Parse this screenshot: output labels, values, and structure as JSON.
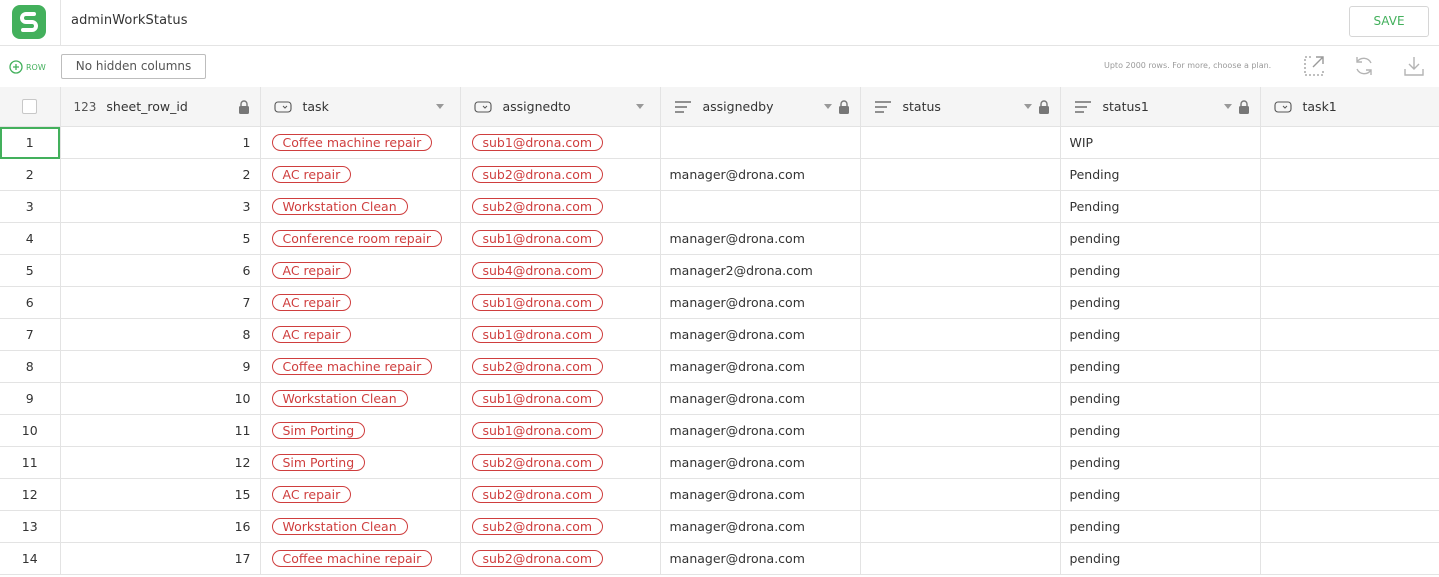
{
  "app": {
    "title": "adminWorkStatus",
    "save_label": "SAVE",
    "brand_color": "#43b05c"
  },
  "toolbar": {
    "add_row_label": "ROW",
    "hidden_columns_label": "No hidden columns",
    "plan_note": "Upto 2000 rows. For more, choose a plan.",
    "icons": [
      "open-external-icon",
      "refresh-icon",
      "download-icon"
    ]
  },
  "columns": [
    {
      "key": "sheet_row_id",
      "label": "sheet_row_id",
      "type_tag": "123",
      "locked": true
    },
    {
      "key": "task",
      "label": "task",
      "type": "select",
      "locked": false
    },
    {
      "key": "assignedto",
      "label": "assignedto",
      "type": "select",
      "locked": false
    },
    {
      "key": "assignedby",
      "label": "assignedby",
      "type": "text",
      "locked": true
    },
    {
      "key": "status",
      "label": "status",
      "type": "text",
      "locked": true
    },
    {
      "key": "status1",
      "label": "status1",
      "type": "text",
      "locked": true
    },
    {
      "key": "task1",
      "label": "task1",
      "type": "select",
      "locked": false
    }
  ],
  "rows": [
    {
      "n": "1",
      "sheet_row_id": "1",
      "task": "Coffee machine repair",
      "assignedto": "sub1@drona.com",
      "assignedby": "",
      "status": "",
      "status1": "WIP",
      "task1": ""
    },
    {
      "n": "2",
      "sheet_row_id": "2",
      "task": "AC repair",
      "assignedto": "sub2@drona.com",
      "assignedby": "manager@drona.com",
      "status": "",
      "status1": "Pending",
      "task1": ""
    },
    {
      "n": "3",
      "sheet_row_id": "3",
      "task": "Workstation Clean",
      "assignedto": "sub2@drona.com",
      "assignedby": "",
      "status": "",
      "status1": "Pending",
      "task1": ""
    },
    {
      "n": "4",
      "sheet_row_id": "5",
      "task": "Conference room repair",
      "assignedto": "sub1@drona.com",
      "assignedby": "manager@drona.com",
      "status": "",
      "status1": "pending",
      "task1": ""
    },
    {
      "n": "5",
      "sheet_row_id": "6",
      "task": "AC repair",
      "assignedto": "sub4@drona.com",
      "assignedby": "manager2@drona.com",
      "status": "",
      "status1": "pending",
      "task1": ""
    },
    {
      "n": "6",
      "sheet_row_id": "7",
      "task": "AC repair",
      "assignedto": "sub1@drona.com",
      "assignedby": "manager@drona.com",
      "status": "",
      "status1": "pending",
      "task1": ""
    },
    {
      "n": "7",
      "sheet_row_id": "8",
      "task": "AC repair",
      "assignedto": "sub1@drona.com",
      "assignedby": "manager@drona.com",
      "status": "",
      "status1": "pending",
      "task1": ""
    },
    {
      "n": "8",
      "sheet_row_id": "9",
      "task": "Coffee machine repair",
      "assignedto": "sub2@drona.com",
      "assignedby": "manager@drona.com",
      "status": "",
      "status1": "pending",
      "task1": ""
    },
    {
      "n": "9",
      "sheet_row_id": "10",
      "task": "Workstation Clean",
      "assignedto": "sub1@drona.com",
      "assignedby": "manager@drona.com",
      "status": "",
      "status1": "pending",
      "task1": ""
    },
    {
      "n": "10",
      "sheet_row_id": "11",
      "task": "Sim Porting",
      "assignedto": "sub1@drona.com",
      "assignedby": "manager@drona.com",
      "status": "",
      "status1": "pending",
      "task1": ""
    },
    {
      "n": "11",
      "sheet_row_id": "12",
      "task": "Sim Porting",
      "assignedto": "sub2@drona.com",
      "assignedby": "manager@drona.com",
      "status": "",
      "status1": "pending",
      "task1": ""
    },
    {
      "n": "12",
      "sheet_row_id": "15",
      "task": "AC repair",
      "assignedto": "sub2@drona.com",
      "assignedby": "manager@drona.com",
      "status": "",
      "status1": "pending",
      "task1": ""
    },
    {
      "n": "13",
      "sheet_row_id": "16",
      "task": "Workstation Clean",
      "assignedto": "sub2@drona.com",
      "assignedby": "manager@drona.com",
      "status": "",
      "status1": "pending",
      "task1": ""
    },
    {
      "n": "14",
      "sheet_row_id": "17",
      "task": "Coffee machine repair",
      "assignedto": "sub2@drona.com",
      "assignedby": "manager@drona.com",
      "status": "",
      "status1": "pending",
      "task1": ""
    }
  ],
  "selected_row": "1",
  "chip_color": "#cf3e3e"
}
